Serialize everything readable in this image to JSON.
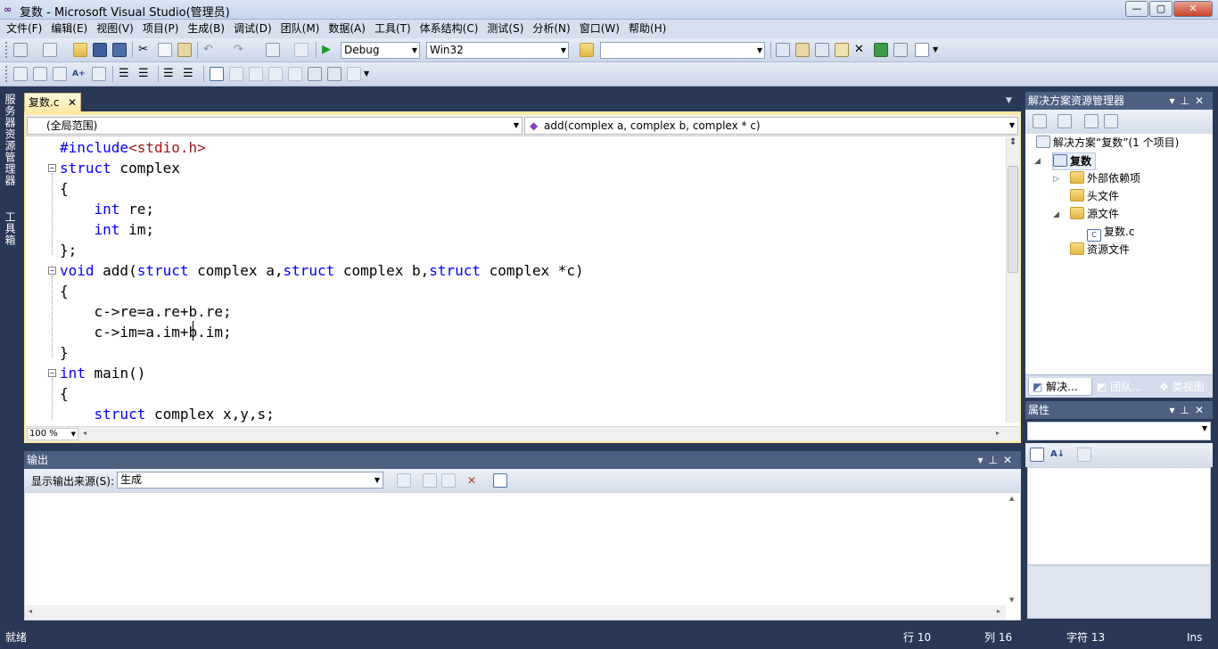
{
  "window": {
    "title": "复数 - Microsoft Visual Studio(管理员)",
    "buttons": {
      "minimize": "—",
      "maximize": "▢",
      "close": "✕"
    }
  },
  "menu": [
    "文件(F)",
    "编辑(E)",
    "视图(V)",
    "项目(P)",
    "生成(B)",
    "调试(D)",
    "团队(M)",
    "数据(A)",
    "工具(T)",
    "体系结构(C)",
    "测试(S)",
    "分析(N)",
    "窗口(W)",
    "帮助(H)"
  ],
  "toolbar": {
    "config": "Debug",
    "platform": "Win32",
    "find_value": ""
  },
  "side_strip": {
    "server_explorer": "服务器资源管理器",
    "toolbox": "工具箱"
  },
  "editor": {
    "tab_label": "复数.c",
    "tab_close": "✕",
    "scope": "(全局范围)",
    "member": "add(complex a, complex b, complex * c)",
    "zoom": "100 %",
    "code": [
      [
        {
          "t": "#include",
          "c": "pp"
        },
        {
          "t": "<stdio.h>",
          "c": "str"
        }
      ],
      [
        {
          "t": "struct",
          "c": "kw"
        },
        {
          "t": " complex",
          "c": ""
        }
      ],
      [
        {
          "t": "{",
          "c": ""
        }
      ],
      [
        {
          "t": "    ",
          "c": ""
        },
        {
          "t": "int",
          "c": "kw"
        },
        {
          "t": " re;",
          "c": ""
        }
      ],
      [
        {
          "t": "    ",
          "c": ""
        },
        {
          "t": "int",
          "c": "kw"
        },
        {
          "t": " im;",
          "c": ""
        }
      ],
      [
        {
          "t": "};",
          "c": ""
        }
      ],
      [
        {
          "t": "void",
          "c": "kw"
        },
        {
          "t": " add(",
          "c": ""
        },
        {
          "t": "struct",
          "c": "kw"
        },
        {
          "t": " complex a,",
          "c": ""
        },
        {
          "t": "struct",
          "c": "kw"
        },
        {
          "t": " complex b,",
          "c": ""
        },
        {
          "t": "struct",
          "c": "kw"
        },
        {
          "t": " complex *c)",
          "c": ""
        }
      ],
      [
        {
          "t": "{",
          "c": ""
        }
      ],
      [
        {
          "t": "    c->re=a.re+b.re;",
          "c": ""
        }
      ],
      [
        {
          "t": "    c->im=a.im+b.im;",
          "c": ""
        }
      ],
      [
        {
          "t": "}",
          "c": ""
        }
      ],
      [
        {
          "t": "int",
          "c": "kw"
        },
        {
          "t": " main()",
          "c": ""
        }
      ],
      [
        {
          "t": "{",
          "c": ""
        }
      ],
      [
        {
          "t": "    ",
          "c": ""
        },
        {
          "t": "struct",
          "c": "kw"
        },
        {
          "t": " complex x,y,s;",
          "c": ""
        }
      ]
    ]
  },
  "output": {
    "title": "输出",
    "source_label": "显示输出来源(S):",
    "source_value": "生成"
  },
  "solution_explorer": {
    "title": "解决方案资源管理器",
    "solution": "解决方案“复数”(1 个项目)",
    "project": "复数",
    "items": {
      "external": "外部依赖项",
      "headers": "头文件",
      "sources": "源文件",
      "file": "复数.c",
      "resources": "资源文件"
    },
    "tabs": [
      "解决...",
      "团队...",
      "类视图"
    ]
  },
  "properties": {
    "title": "属性"
  },
  "status": {
    "ready": "就绪",
    "line": "行 10",
    "col": "列 16",
    "ch": "字符 13",
    "mode": "Ins"
  },
  "colors": {
    "keyword": "#0000ff",
    "string": "#a31515",
    "chrome": "#293955",
    "tab_active": "#ffe9a6"
  }
}
